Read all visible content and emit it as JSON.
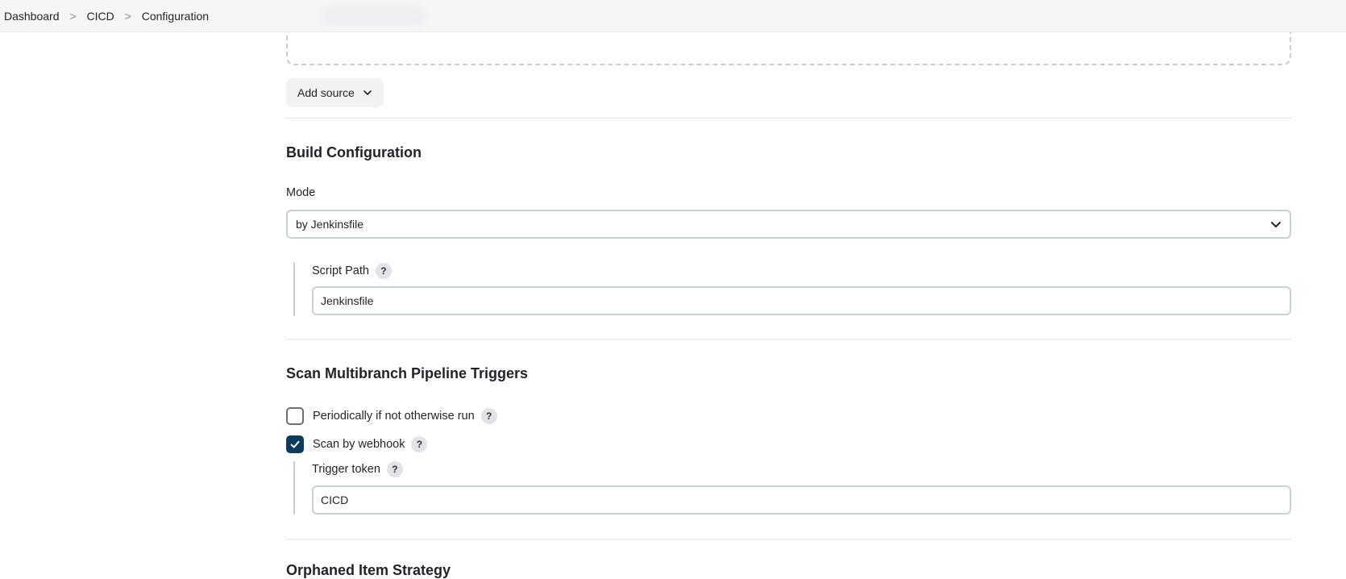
{
  "breadcrumb": {
    "items": [
      "Dashboard",
      "CICD",
      "Configuration"
    ],
    "separator": ">"
  },
  "sources": {
    "add_source_label": "Add source"
  },
  "build_config": {
    "title": "Build Configuration",
    "mode_label": "Mode",
    "mode_value": "by Jenkinsfile",
    "script_path_label": "Script Path",
    "script_path_value": "Jenkinsfile"
  },
  "triggers": {
    "title": "Scan Multibranch Pipeline Triggers",
    "periodic_label": "Periodically if not otherwise run",
    "periodic_checked": false,
    "webhook_label": "Scan by webhook",
    "webhook_checked": true,
    "token_label": "Trigger token",
    "token_value": "CICD"
  },
  "next_section": {
    "title": "Orphaned Item Strategy"
  },
  "colors": {
    "checkbox_checked": "#0b3c5d",
    "topbar_bg": "#f6f6f8"
  },
  "help_glyph": "?"
}
